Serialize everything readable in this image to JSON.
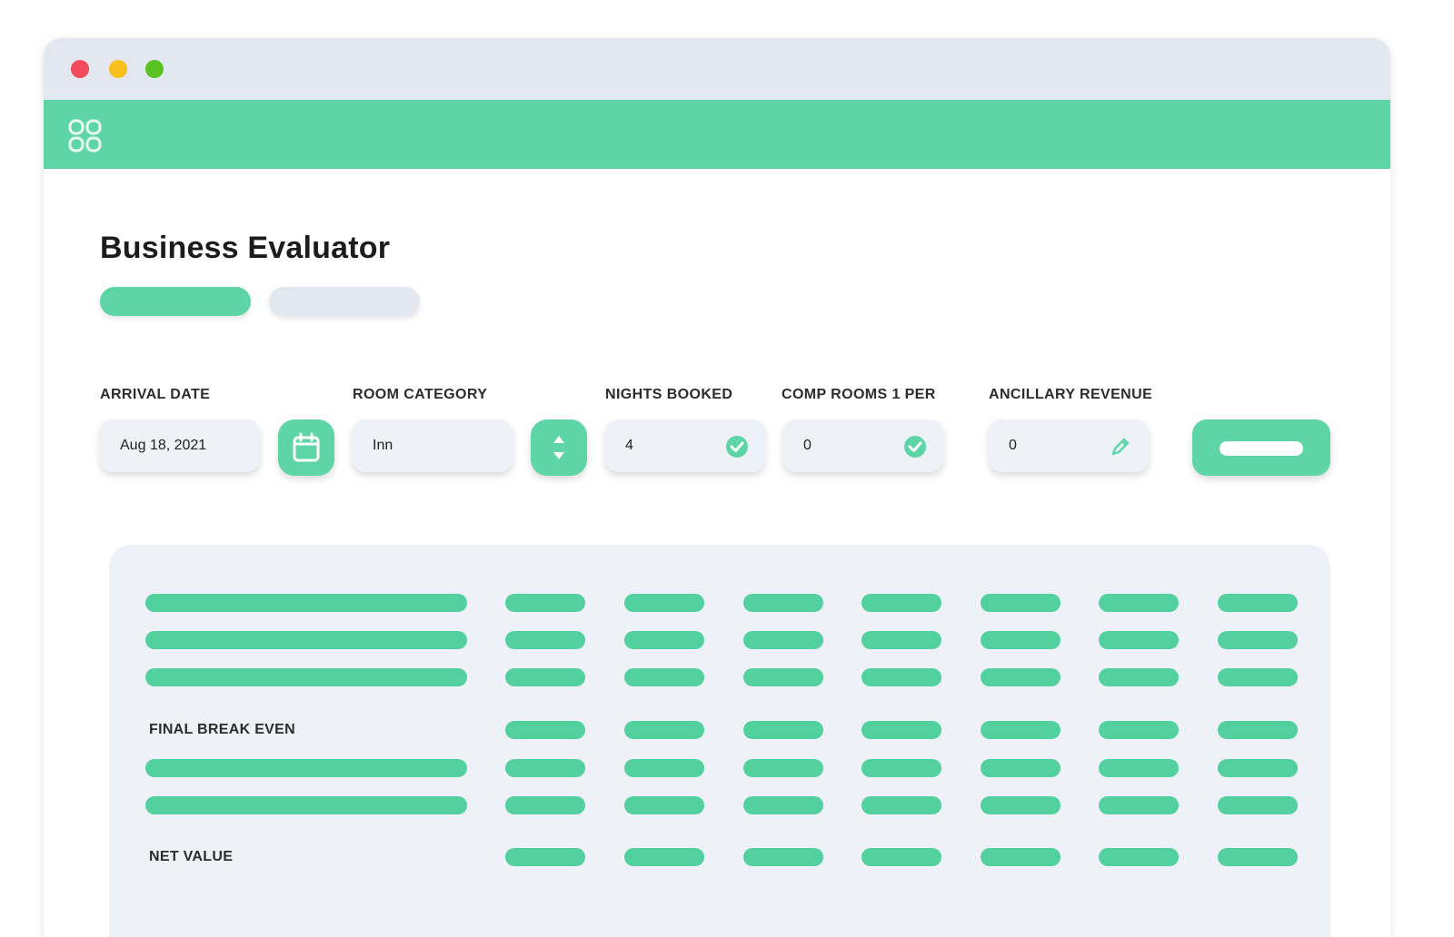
{
  "colors": {
    "accent": "#5dd5a6",
    "accent_bar": "#52d19f",
    "inactive_pill": "#e2e7f0",
    "traffic_red": "#f2495c",
    "traffic_yellow": "#f9bf1d",
    "traffic_green": "#58c322"
  },
  "window": {
    "controls": [
      "close",
      "minimize",
      "maximize"
    ]
  },
  "appbar": {
    "logo_icon": "grid-logo-icon"
  },
  "page": {
    "title": "Business Evaluator",
    "tabs": [
      {
        "state": "active"
      },
      {
        "state": "inactive"
      }
    ]
  },
  "form": {
    "arrival_date": {
      "label": "ARRIVAL DATE",
      "value": "Aug 18, 2021"
    },
    "calendar_button": {
      "icon": "calendar-icon"
    },
    "room_category": {
      "label": "ROOM CATEGORY",
      "value": "Inn"
    },
    "category_button": {
      "icon": "up-down-icon"
    },
    "nights_booked": {
      "label": "NIGHTS BOOKED",
      "value": "4",
      "icon": "check-circle-icon"
    },
    "comp_rooms": {
      "label": "COMP ROOMS 1 PER",
      "value": "0",
      "icon": "check-circle-icon"
    },
    "ancillary_revenue": {
      "label": "ANCILLARY REVENUE",
      "value": "0",
      "icon": "pencil-icon"
    },
    "submit_button": {
      "label": ""
    }
  },
  "table": {
    "column_count": 7,
    "rows": [
      {
        "label": ""
      },
      {
        "label": ""
      },
      {
        "label": ""
      },
      {
        "label": "FINAL BREAK EVEN"
      },
      {
        "label": ""
      },
      {
        "label": ""
      },
      {
        "label": "NET VALUE"
      }
    ]
  }
}
